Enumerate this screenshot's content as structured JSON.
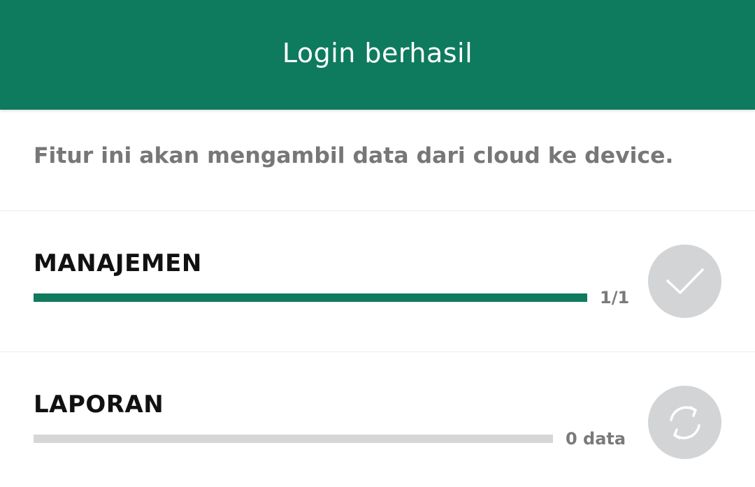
{
  "header": {
    "title": "Login berhasil"
  },
  "description": "Fitur ini akan mengambil data dari cloud ke device.",
  "colors": {
    "primary": "#0e7a5e",
    "track": "#d6d6d6",
    "status_button": "#d3d4d6"
  },
  "sync_items": [
    {
      "label": "MANAJEMEN",
      "count_text": "1/1",
      "progress": 1.0,
      "status_icon": "check-icon"
    },
    {
      "label": "LAPORAN",
      "count_text": "0 data",
      "progress": 0.0,
      "status_icon": "sync-icon"
    }
  ]
}
